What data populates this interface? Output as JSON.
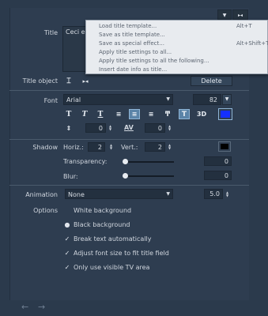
{
  "top_buttons": {
    "dropdown": "▼",
    "resize": "▸◂"
  },
  "title_row": {
    "label": "Title",
    "value": "Ceci es"
  },
  "menu": {
    "items": [
      {
        "label": "Load title template...",
        "shortcut": "Alt+T"
      },
      {
        "label": "Save as title template...",
        "shortcut": ""
      },
      {
        "label": "Save as special effect...",
        "shortcut": "Alt+Shift+T"
      },
      {
        "label": "Apply title settings to all...",
        "shortcut": ""
      },
      {
        "label": "Apply title settings to all the following...",
        "shortcut": ""
      },
      {
        "label": "Insert date info as title...",
        "shortcut": ""
      }
    ]
  },
  "title_object": {
    "label": "Title object",
    "delete_label": "Delete"
  },
  "font": {
    "label": "Font",
    "family": "Arial",
    "size": "82",
    "style_icons": [
      "T",
      "T",
      "T"
    ],
    "three_d": "3D",
    "color": "#1430ff",
    "spacing_value": "0",
    "kerning_label": "AV",
    "kerning_value": "0"
  },
  "shadow": {
    "label": "Shadow",
    "horiz_label": "Horiz.:",
    "horiz_value": "2",
    "vert_label": "Vert.:",
    "vert_value": "2",
    "transparency_label": "Transparency:",
    "transparency_value": "0",
    "blur_label": "Blur:",
    "blur_value": "0",
    "color": "#000000"
  },
  "animation": {
    "label": "Animation",
    "value": "None",
    "duration": "5.0"
  },
  "options": {
    "label": "Options",
    "items": [
      {
        "label": "White background",
        "mark": ""
      },
      {
        "label": "Black background",
        "mark": "●"
      },
      {
        "label": "Break text automatically",
        "mark": "✓"
      },
      {
        "label": "Adjust font size to fit title field",
        "mark": "✓"
      },
      {
        "label": "Only use visible TV area",
        "mark": "✓"
      }
    ]
  },
  "footer": {
    "back": "←",
    "forward": "→"
  }
}
